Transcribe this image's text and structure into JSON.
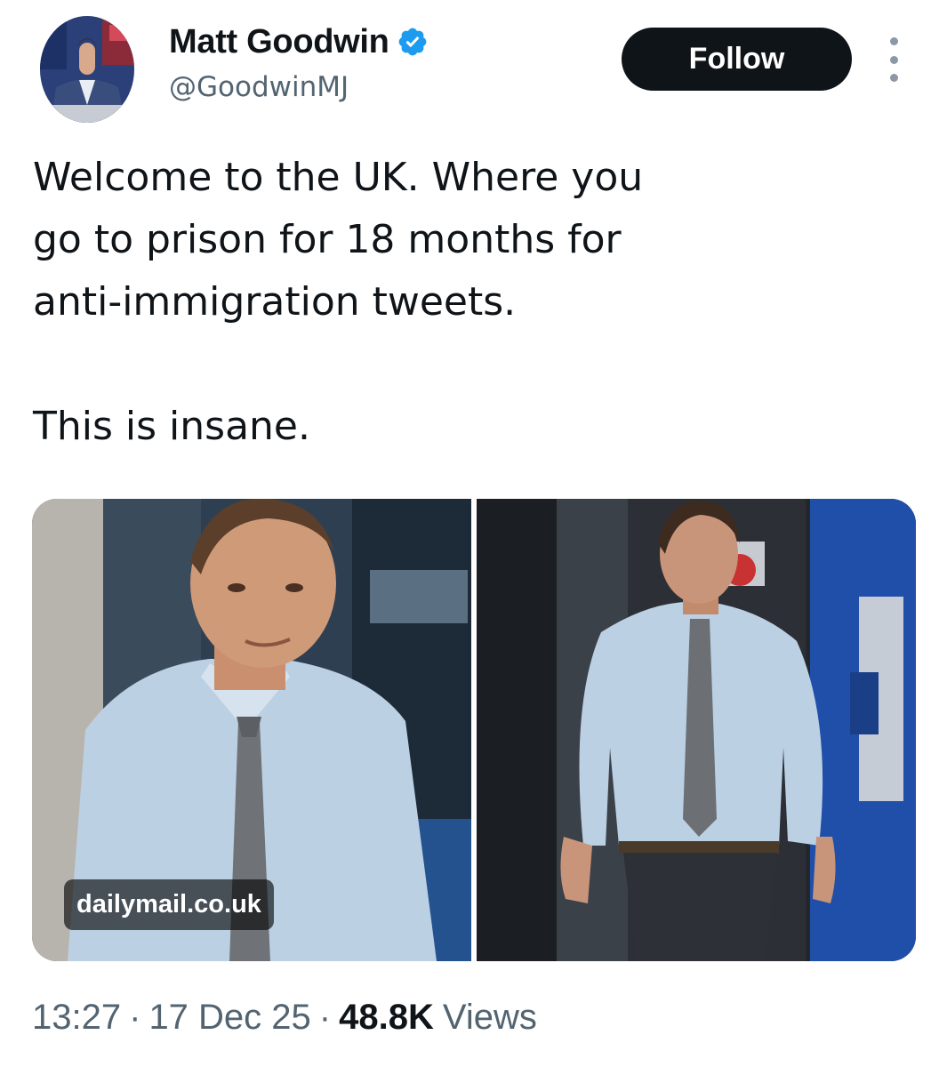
{
  "author": {
    "name": "Matt Goodwin",
    "handle": "@GoodwinMJ",
    "verified": true,
    "verified_color": "#1d9bf0"
  },
  "actions": {
    "follow_label": "Follow",
    "more_icon": "more-options-icon"
  },
  "tweet": {
    "lines": [
      "Welcome to the UK. Where you\ngo to prison for 18 months for\nanti-immigration tweets.",
      "This is insane."
    ]
  },
  "media": {
    "photo_count": 2,
    "source_label": "dailymail.co.uk"
  },
  "meta": {
    "time": "13:27",
    "separator": "·",
    "date": "17 Dec 25",
    "views_count": "48.8K",
    "views_label": "Views"
  },
  "colors": {
    "text_primary": "#0f1419",
    "text_secondary": "#536471",
    "button_bg": "#0f1419"
  }
}
